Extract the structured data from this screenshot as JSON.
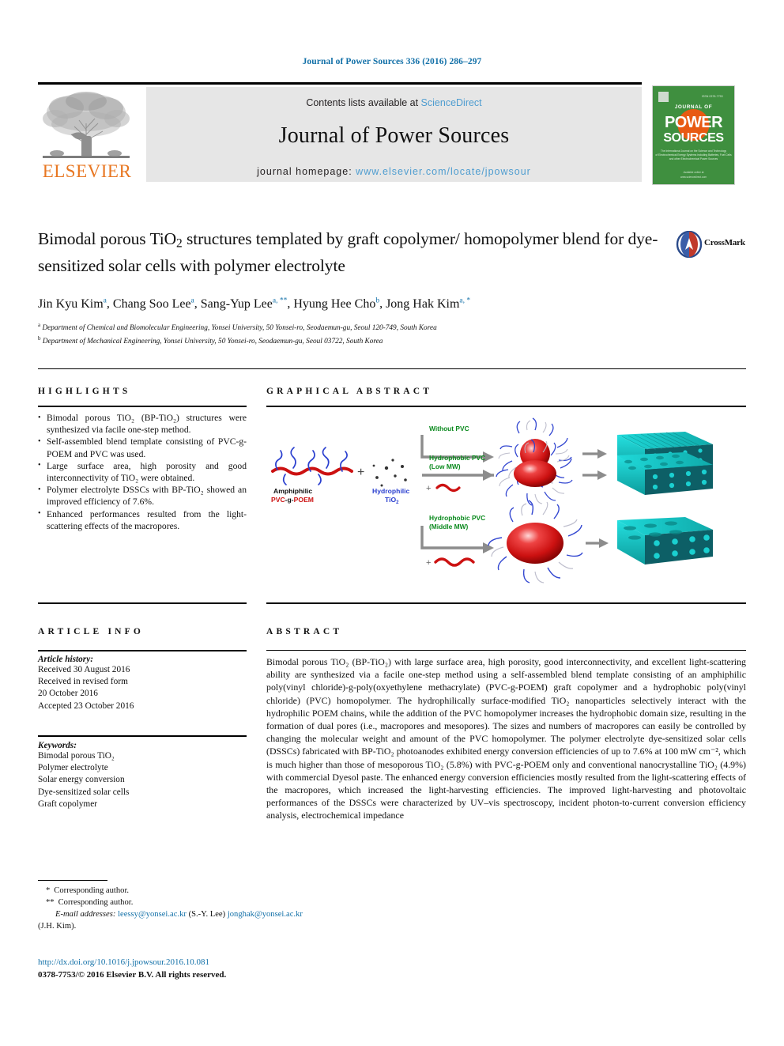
{
  "citation": "Journal of Power Sources 336 (2016) 286–297",
  "masthead": {
    "contents_prefix": "Contents lists available at ",
    "sciencedirect": "ScienceDirect",
    "journal_name": "Journal of Power Sources",
    "homepage_prefix": "journal homepage: ",
    "homepage_url": "www.elsevier.com/locate/jpowsour",
    "publisher": "ELSEVIER",
    "cover_title_small": "JOURNAL OF",
    "cover_title_1": "POWER",
    "cover_title_2": "SOURCES",
    "accent_link_color": "#4f9dd0",
    "elsevier_orange": "#e87722",
    "cover_green": "#3f8f3f"
  },
  "title": {
    "line1": "Bimodal porous TiO",
    "sub1": "2",
    "line1b": " structures templated by graft copolymer/",
    "line2": "homopolymer blend for dye-sensitized solar cells with polymer",
    "line3": "electrolyte"
  },
  "crossmark": {
    "label": "CrossMark"
  },
  "authors": {
    "list": [
      {
        "name": "Jin Kyu Kim",
        "marks": "a"
      },
      {
        "name": "Chang Soo Lee",
        "marks": "a"
      },
      {
        "name": "Sang-Yup Lee",
        "marks": "a, **"
      },
      {
        "name": "Hyung Hee Cho",
        "marks": "b"
      },
      {
        "name": "Jong Hak Kim",
        "marks": "a, *"
      }
    ]
  },
  "affiliations": [
    {
      "mark": "a",
      "text": "Department of Chemical and Biomolecular Engineering, Yonsei University, 50 Yonsei-ro, Seodaemun-gu, Seoul 120-749, South Korea"
    },
    {
      "mark": "b",
      "text": "Department of Mechanical Engineering, Yonsei University, 50 Yonsei-ro, Seodaemun-gu, Seoul 03722, South Korea"
    }
  ],
  "sections": {
    "highlights_heading": "HIGHLIGHTS",
    "graphical_abstract_heading": "GRAPHICAL ABSTRACT",
    "article_info_heading": "ARTICLE INFO",
    "abstract_heading": "ABSTRACT"
  },
  "highlights": [
    "Bimodal porous TiO₂ (BP-TiO₂) structures were synthesized via facile one-step method.",
    "Self-assembled blend template consisting of PVC-g-POEM and PVC was used.",
    "Large surface area, high porosity and good interconnectivity of TiO₂ were obtained.",
    "Polymer electrolyte DSSCs with BP-TiO₂ showed an improved efficiency of 7.6%.",
    "Enhanced performances resulted from the light-scattering effects of the macropores."
  ],
  "article_info": {
    "history_label": "Article history:",
    "history_lines": [
      "Received 30 August 2016",
      "Received in revised form",
      "20 October 2016",
      "Accepted 23 October 2016"
    ],
    "keywords_label": "Keywords:",
    "keywords": [
      "Bimodal porous TiO₂",
      "Polymer electrolyte",
      "Solar energy conversion",
      "Dye-sensitized solar cells",
      "Graft copolymer"
    ]
  },
  "abstract": {
    "text": "Bimodal porous TiO₂ (BP-TiO₂) with large surface area, high porosity, good interconnectivity, and excellent light-scattering ability are synthesized via a facile one-step method using a self-assembled blend template consisting of an amphiphilic poly(vinyl chloride)-g-poly(oxyethylene methacrylate) (PVC-g-POEM) graft copolymer and a hydrophobic poly(vinyl chloride) (PVC) homopolymer. The hydrophilically surface-modified TiO₂ nanoparticles selectively interact with the hydrophilic POEM chains, while the addition of the PVC homopolymer increases the hydrophobic domain size, resulting in the formation of dual pores (i.e., macropores and mesopores). The sizes and numbers of macropores can easily be controlled by changing the molecular weight and amount of the PVC homopolymer. The polymer electrolyte dye-sensitized solar cells (DSSCs) fabricated with BP-TiO₂ photoanodes exhibited energy conversion efficiencies of up to 7.6% at 100 mW cm⁻², which is much higher than those of mesoporous TiO₂ (5.8%) with PVC-g-POEM only and conventional nanocrystalline TiO₂ (4.9%) with commercial Dyesol paste. The enhanced energy conversion efficiencies mostly resulted from the light-scattering effects of the macropores, which increased the light-harvesting efficiencies. The improved light-harvesting and photovoltaic performances of the DSSCs were characterized by UV–vis spectroscopy, incident photon-to-current conversion efficiency analysis, electrochemical impedance"
  },
  "graphical_abstract": {
    "reactant_label_1": "Amphiphilic",
    "reactant_label_2": "PVC-g-POEM",
    "reactant_label_3": "Hydrophilic",
    "reactant_label_4": "TiO₂",
    "plus": "+",
    "routes": [
      {
        "label_1": "Without PVC",
        "label_2": ""
      },
      {
        "label_1": "Hydrophobic PVC",
        "label_2": "(Low MW)"
      },
      {
        "label_1": "Hydrophobic PVC",
        "label_2": "(Middle MW)"
      }
    ],
    "colors": {
      "green_text": "#0b8a1e",
      "red_polymer": "#cc1111",
      "blue_polymer": "#2a3fcf",
      "teal_block": "#17c4c4",
      "arrow_gray": "#8c8c8c"
    }
  },
  "footnotes": {
    "star_single": "*",
    "star_double": "**",
    "corresponding": "Corresponding author.",
    "email_label": "E-mail addresses:",
    "email_1": "leessy@yonsei.ac.kr",
    "email_1_owner": "(S.-Y. Lee)",
    "email_2": "jonghak@yonsei.ac.kr",
    "email_2_owner": "(J.H. Kim)."
  },
  "doi": {
    "url": "http://dx.doi.org/10.1016/j.jpowsour.2016.10.081",
    "copyright": "0378-7753/© 2016 Elsevier B.V. All rights reserved."
  }
}
